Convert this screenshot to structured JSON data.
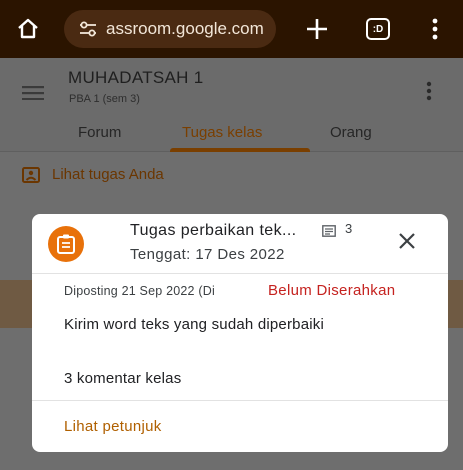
{
  "browser": {
    "url": "assroom.google.com",
    "tabs_count_label": ":D"
  },
  "course": {
    "title": "MUHADATSAH 1",
    "subtitle": "PBA 1 (sem 3)"
  },
  "tabs": [
    {
      "label": "Forum"
    },
    {
      "label": "Tugas kelas"
    },
    {
      "label": "Orang"
    }
  ],
  "active_tab": "Tugas kelas",
  "view_work_label": "Lihat tugas Anda",
  "dialog": {
    "title": "Tugas perbaikan tek...",
    "comment_count": "3",
    "due": "Tenggat: 17 Des 2022",
    "posted": "Diposting 21 Sep 2022 (Di",
    "status": "Belum Diserahkan",
    "instructions": "Kirim word teks yang sudah diperbaiki",
    "class_comments": "3 komentar kelas",
    "view_instructions_label": "Lihat petunjuk"
  },
  "colors": {
    "browser_bar": "#2b1400",
    "accent": "#e8710a",
    "status_red": "#c5221f",
    "link_orange": "#b06000"
  },
  "icons": [
    "home-icon",
    "site-settings-icon",
    "new-tab-icon",
    "tab-switcher-icon",
    "more-vert-icon",
    "hamburger-icon",
    "assignment-icon",
    "comment-icon",
    "close-icon"
  ]
}
